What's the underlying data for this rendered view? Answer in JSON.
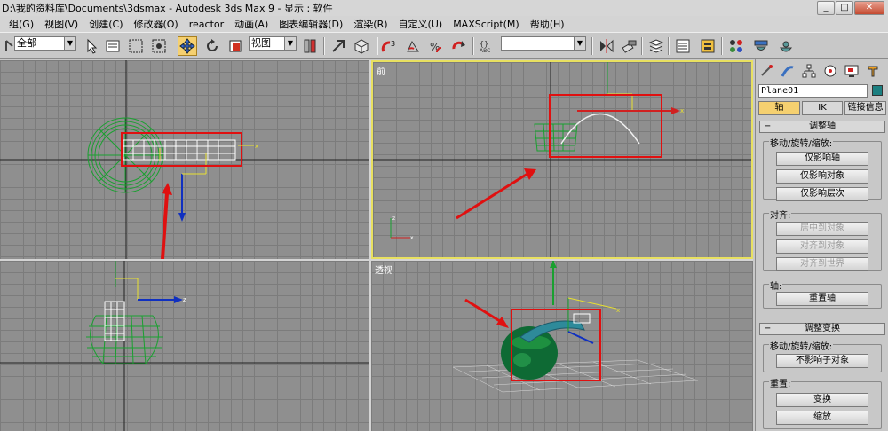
{
  "window": {
    "title": "D:\\我的资料库\\Documents\\3dsmax    - Autodesk 3ds Max 9     - 显示 : 软件",
    "buttons": [
      "_",
      "□",
      "✕"
    ]
  },
  "menu": {
    "items": [
      "组(G)",
      "视图(V)",
      "创建(C)",
      "修改器(O)",
      "reactor",
      "动画(A)",
      "图表编辑器(D)",
      "渲染(R)",
      "自定义(U)",
      "MAXScript(M)",
      "帮助(H)"
    ]
  },
  "toolbar": {
    "selection_filter": "全部",
    "reference_coord": "视图",
    "named_selection": "",
    "icons": [
      "undo-icon",
      "select-icon",
      "select-region-icon",
      "window-crossing-icon",
      "move-icon",
      "rotate-icon",
      "scale-icon",
      "pivot-icon",
      "manipulate-icon",
      "snap-icon",
      "angle-snap-icon",
      "percent-snap-icon",
      "spinner-snap-icon",
      "edit-named-selection-icon",
      "mirror-icon",
      "align-icon",
      "layer-icon",
      "curve-editor-icon",
      "schematic-icon",
      "material-editor-icon",
      "render-setup-icon",
      "quick-render-icon"
    ]
  },
  "viewports": {
    "top": {
      "label": ""
    },
    "front": {
      "label": "前"
    },
    "left": {
      "label": ""
    },
    "perspective": {
      "label": "透视"
    }
  },
  "command_panel": {
    "object_name": "Plane01",
    "object_color": "#1c7f80",
    "tabs": [
      "create-icon",
      "modify-icon",
      "hierarchy-icon",
      "motion-icon",
      "display-icon",
      "utilities-icon"
    ],
    "subtabs": [
      "轴",
      "IK",
      "链接信息"
    ],
    "adjust_pivot": {
      "header": "调整轴",
      "move_group_label": "移动/旋转/缩放:",
      "buttons": [
        "仅影响轴",
        "仅影响对象",
        "仅影响层次"
      ],
      "align_group_label": "对齐:",
      "align_buttons": [
        "居中到对象",
        "对齐到对象",
        "对齐到世界"
      ],
      "pivot_group_label": "轴:",
      "reset_pivot": "重置轴"
    },
    "adjust_transform": {
      "header": "调整变换",
      "move_group_label": "移动/旋转/缩放:",
      "dont_affect_children": "不影响子对象",
      "reset_group_label": "重置:",
      "reset_buttons": [
        "变换",
        "缩放"
      ]
    }
  },
  "colors": {
    "viewport_bg": "#8f8f8f",
    "grid": "#7c7c7c",
    "active_border": "#e8e060",
    "wire_green": "#2a9a3a",
    "highlight_red": "#e01010",
    "active_tab": "#f5d070"
  }
}
